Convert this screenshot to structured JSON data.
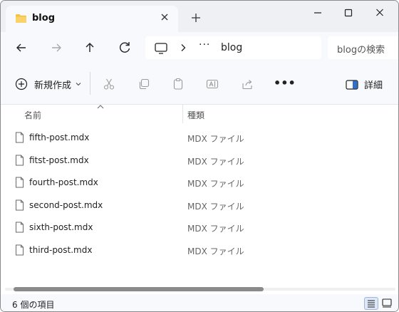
{
  "tab": {
    "title": "blog"
  },
  "address": {
    "ellipsis": "···",
    "crumb": "blog"
  },
  "search": {
    "placeholder": "blogの検索"
  },
  "commandbar": {
    "new_label": "新規作成",
    "details_label": "詳細",
    "more": "•••"
  },
  "columns": {
    "name": "名前",
    "type": "種類"
  },
  "files": [
    {
      "name": "fifth-post.mdx",
      "type": "MDX ファイル"
    },
    {
      "name": "fitst-post.mdx",
      "type": "MDX ファイル"
    },
    {
      "name": "fourth-post.mdx",
      "type": "MDX ファイル"
    },
    {
      "name": "second-post.mdx",
      "type": "MDX ファイル"
    },
    {
      "name": "sixth-post.mdx",
      "type": "MDX ファイル"
    },
    {
      "name": "third-post.mdx",
      "type": "MDX ファイル"
    }
  ],
  "status": {
    "item_count": "6 個の項目"
  },
  "scroll": {
    "horizontal_position": 0
  },
  "icons": {
    "folder": "folder-icon",
    "close": "close-icon",
    "new_tab": "plus-icon",
    "minimize": "minimize-icon",
    "maximize": "maximize-icon",
    "close_window": "close-window-icon",
    "back": "back-arrow-icon",
    "forward": "forward-arrow-icon",
    "up": "up-arrow-icon",
    "refresh": "refresh-icon",
    "pc": "monitor-icon",
    "cut": "scissors-icon",
    "copy": "copy-icon",
    "paste": "paste-icon",
    "rename": "rename-icon",
    "share": "share-icon",
    "details": "details-pane-icon",
    "file": "file-icon",
    "list_view": "list-view-icon",
    "tiles_view": "tiles-view-icon"
  },
  "colors": {
    "folder": "#f5c146",
    "chrome_bg": "#eef0f4",
    "pane_bg": "#f7f9fc",
    "scroll_thumb": "#8a8a8a",
    "active_view": "#dce7f7"
  }
}
